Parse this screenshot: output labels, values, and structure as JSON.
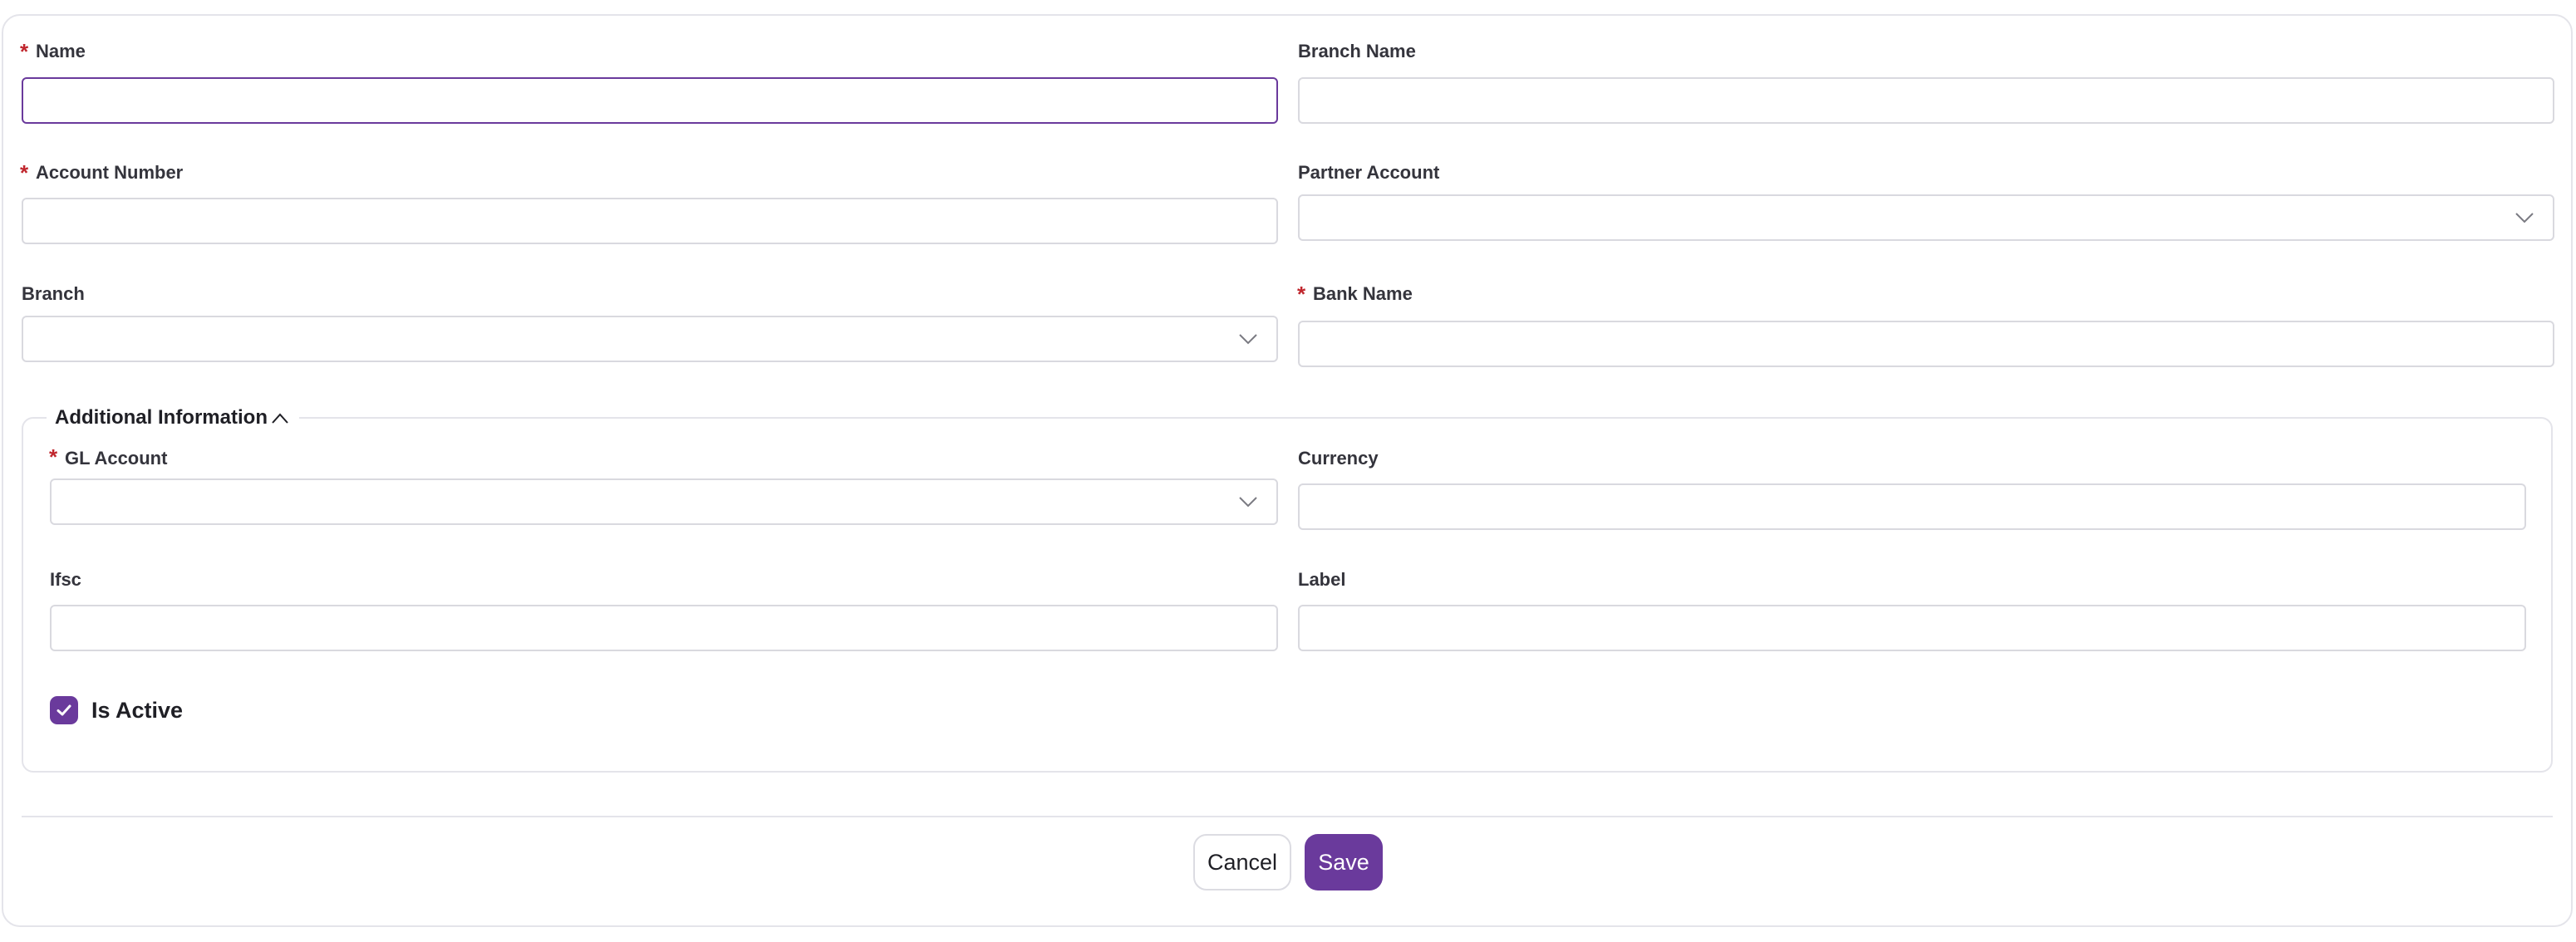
{
  "form": {
    "name": {
      "label": "Name",
      "required": "*",
      "value": ""
    },
    "branch_name": {
      "label": "Branch Name",
      "value": ""
    },
    "account_number": {
      "label": "Account Number",
      "required": "*",
      "value": ""
    },
    "partner_account": {
      "label": "Partner Account",
      "value": ""
    },
    "branch": {
      "label": "Branch",
      "value": ""
    },
    "bank_name": {
      "label": "Bank Name",
      "required": "*",
      "value": ""
    }
  },
  "additional": {
    "title": "Additional Information",
    "gl_account": {
      "label": "GL Account",
      "required": "*",
      "value": ""
    },
    "currency": {
      "label": "Currency",
      "value": ""
    },
    "ifsc": {
      "label": "Ifsc",
      "value": ""
    },
    "label_field": {
      "label": "Label",
      "value": ""
    },
    "is_active": {
      "label": "Is Active",
      "checked": true
    }
  },
  "actions": {
    "cancel": "Cancel",
    "save": "Save"
  },
  "colors": {
    "accent": "#6a3a9c",
    "required": "#c0262d",
    "border": "#d9d9df"
  },
  "icons": {
    "select": "chevron-down-icon",
    "collapse": "chevron-up-icon",
    "check": "check-icon"
  }
}
